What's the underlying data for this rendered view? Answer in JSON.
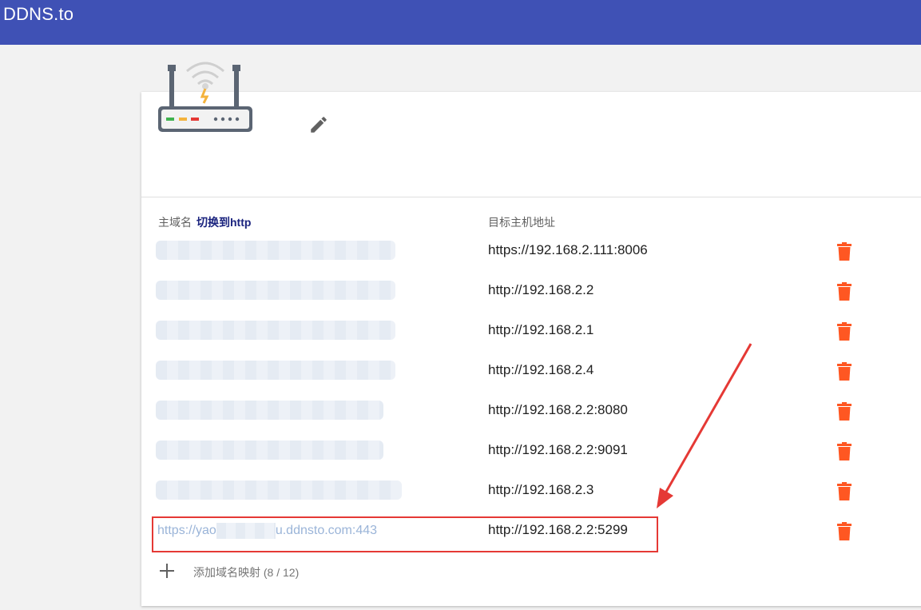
{
  "header": {
    "title": "DDNS.to"
  },
  "icons": {
    "router": "router-icon",
    "edit": "pencil-icon",
    "delete": "trash-icon",
    "add": "plus-icon"
  },
  "table": {
    "domain_header": "主域名",
    "switch_label": "切换到http",
    "target_header": "目标主机地址",
    "rows": [
      {
        "domain": "",
        "target": "https://192.168.2.111:8006"
      },
      {
        "domain": "",
        "target": "http://192.168.2.2"
      },
      {
        "domain": "",
        "target": "http://192.168.2.1"
      },
      {
        "domain": "",
        "target": "http://192.168.2.4"
      },
      {
        "domain": "",
        "target": "http://192.168.2.2:8080"
      },
      {
        "domain": "",
        "target": "http://192.168.2.2:9091"
      },
      {
        "domain": "",
        "target": "http://192.168.2.3"
      },
      {
        "domain_prefix": "https://yao",
        "domain_suffix": "u.ddnsto.com:443",
        "target": "http://192.168.2.2:5299"
      }
    ]
  },
  "add": {
    "label": "添加域名映射 (8 / 12)"
  },
  "colors": {
    "header_bg": "#3f51b5",
    "delete_icon": "#ff5722",
    "highlight": "#e53935",
    "switch_link": "#1a237e"
  }
}
